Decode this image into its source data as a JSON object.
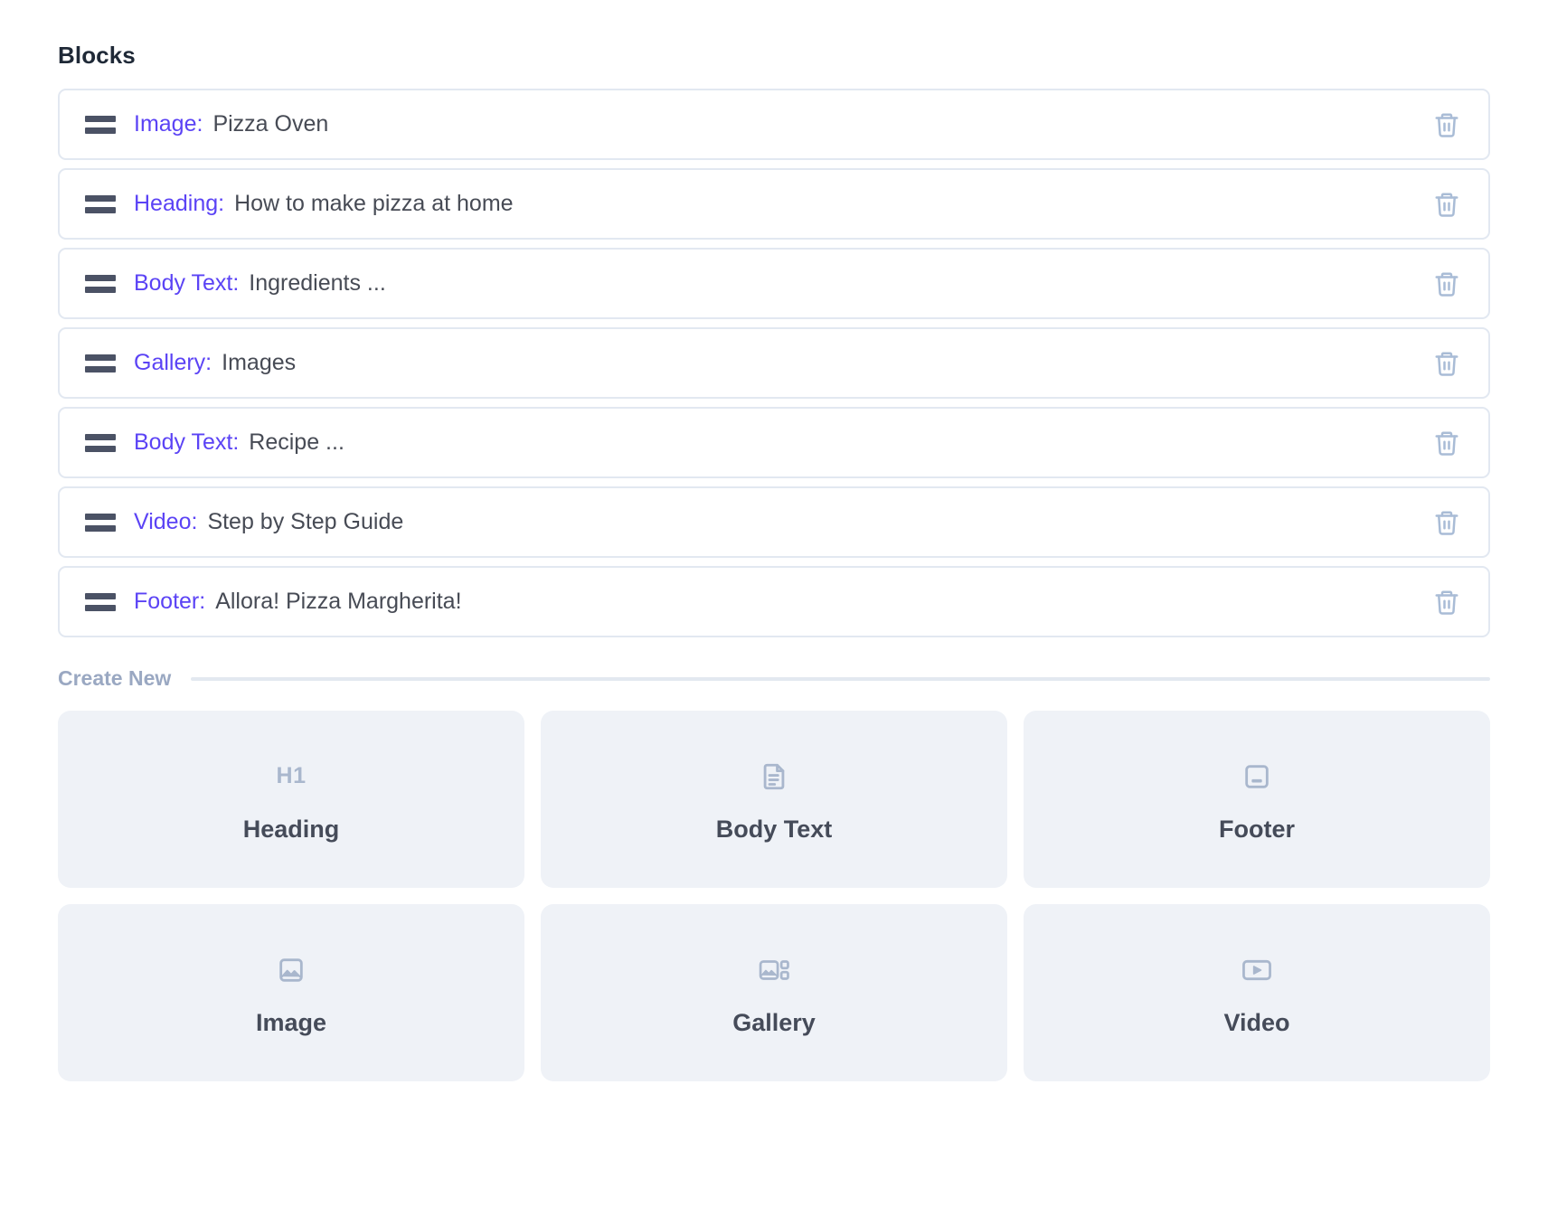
{
  "section": {
    "title": "Blocks"
  },
  "blocks": [
    {
      "type": "Image:",
      "value": "Pizza Oven",
      "delete_icon": "trash-icon",
      "handle_icon": "drag-handle-icon"
    },
    {
      "type": "Heading:",
      "value": "How to make pizza at home",
      "delete_icon": "trash-icon",
      "handle_icon": "drag-handle-icon"
    },
    {
      "type": "Body Text:",
      "value": "Ingredients ...",
      "delete_icon": "trash-icon",
      "handle_icon": "drag-handle-icon"
    },
    {
      "type": "Gallery:",
      "value": "Images",
      "delete_icon": "trash-icon",
      "handle_icon": "drag-handle-icon"
    },
    {
      "type": "Body Text:",
      "value": "Recipe ...",
      "delete_icon": "trash-icon",
      "handle_icon": "drag-handle-icon"
    },
    {
      "type": "Video:",
      "value": "Step by Step Guide",
      "delete_icon": "trash-icon",
      "handle_icon": "drag-handle-icon"
    },
    {
      "type": "Footer:",
      "value": "Allora! Pizza Margherita!",
      "delete_icon": "trash-icon",
      "handle_icon": "drag-handle-icon"
    }
  ],
  "create_new": {
    "label": "Create New",
    "cards": [
      {
        "label": "Heading",
        "icon": "h1-icon",
        "icon_text": "H1"
      },
      {
        "label": "Body Text",
        "icon": "document-icon",
        "icon_text": ""
      },
      {
        "label": "Footer",
        "icon": "footer-icon",
        "icon_text": ""
      },
      {
        "label": "Image",
        "icon": "image-icon",
        "icon_text": ""
      },
      {
        "label": "Gallery",
        "icon": "gallery-icon",
        "icon_text": ""
      },
      {
        "label": "Video",
        "icon": "video-icon",
        "icon_text": ""
      }
    ]
  },
  "colors": {
    "accent": "#5b43f5",
    "block_border": "#e2e8f1",
    "card_background": "#eff2f7",
    "muted": "#a9b7cd",
    "text": "#474b55",
    "trash": "#a9bcd6"
  }
}
